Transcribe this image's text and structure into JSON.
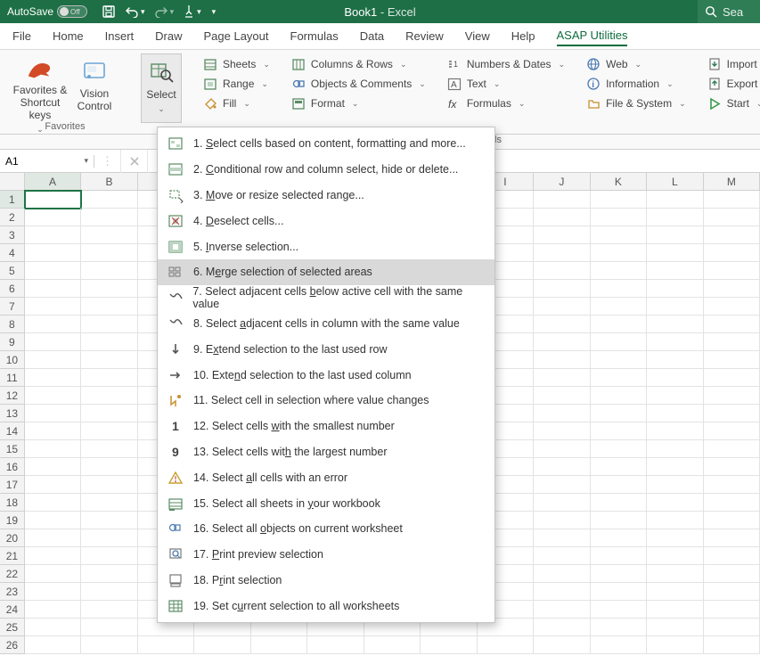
{
  "titlebar": {
    "autosave_label": "AutoSave",
    "autosave_state": "Off",
    "title_doc": "Book1",
    "title_app": "Excel",
    "search_placeholder": "Sea"
  },
  "tabs": {
    "items": [
      {
        "label": "File"
      },
      {
        "label": "Home"
      },
      {
        "label": "Insert"
      },
      {
        "label": "Draw"
      },
      {
        "label": "Page Layout"
      },
      {
        "label": "Formulas"
      },
      {
        "label": "Data"
      },
      {
        "label": "Review"
      },
      {
        "label": "View"
      },
      {
        "label": "Help"
      },
      {
        "label": "ASAP Utilities"
      }
    ],
    "active_index": 10
  },
  "ribbon": {
    "favorites": {
      "label": "Favorites",
      "big1": "Favorites &\nShortcut keys",
      "big2": "Vision\nControl"
    },
    "select_big": "Select",
    "col1": [
      {
        "label": "Sheets"
      },
      {
        "label": "Range"
      },
      {
        "label": "Fill"
      }
    ],
    "col2": [
      {
        "label": "Columns & Rows"
      },
      {
        "label": "Objects & Comments"
      },
      {
        "label": "Format"
      }
    ],
    "col3": [
      {
        "label": "Numbers & Dates"
      },
      {
        "label": "Text"
      },
      {
        "label": "Formulas"
      }
    ],
    "col4": [
      {
        "label": "Web"
      },
      {
        "label": "Information"
      },
      {
        "label": "File & System"
      }
    ],
    "col5": [
      {
        "label": "Import"
      },
      {
        "label": "Export"
      },
      {
        "label": "Start"
      }
    ],
    "cells_label": "ls"
  },
  "namebox": {
    "value": "A1"
  },
  "columns": [
    "A",
    "B",
    "",
    "",
    "",
    "",
    "",
    "",
    "I",
    "J",
    "K",
    "L",
    "M"
  ],
  "row_count": 26,
  "active_cell": {
    "row": 1,
    "col": 0
  },
  "dropdown": {
    "highlight_index": 5,
    "items": [
      {
        "num": "1.",
        "label": "Select cells based on content, formatting and more...",
        "ukey": "S"
      },
      {
        "num": "2.",
        "label": "Conditional row and column select, hide or delete...",
        "ukey": "C"
      },
      {
        "num": "3.",
        "label": "Move or resize selected range...",
        "ukey": "M"
      },
      {
        "num": "4.",
        "label": "Deselect cells...",
        "ukey": "D"
      },
      {
        "num": "5.",
        "label": "Inverse selection...",
        "ukey": "I"
      },
      {
        "num": "6.",
        "label": "Merge selection of selected areas",
        "ukey": "e"
      },
      {
        "num": "7.",
        "label": "Select adjacent cells below active cell with the same value",
        "ukey": "b"
      },
      {
        "num": "8.",
        "label": "Select adjacent cells in column with the same value",
        "ukey": "a"
      },
      {
        "num": "9.",
        "label": "Extend selection to the last used row",
        "ukey": "x"
      },
      {
        "num": "10.",
        "label": "Extend selection to the last used column",
        "ukey": "n"
      },
      {
        "num": "11.",
        "label": "Select cell in selection where value changes",
        "ukey": ""
      },
      {
        "num": "12.",
        "label": "Select cells with the smallest number",
        "ukey": "w"
      },
      {
        "num": "13.",
        "label": "Select cells with the largest number",
        "ukey": "h"
      },
      {
        "num": "14.",
        "label": "Select all cells with an error",
        "ukey": "a"
      },
      {
        "num": "15.",
        "label": "Select all sheets in your workbook",
        "ukey": "y"
      },
      {
        "num": "16.",
        "label": "Select all objects on current worksheet",
        "ukey": "o"
      },
      {
        "num": "17.",
        "label": "Print preview selection",
        "ukey": "P"
      },
      {
        "num": "18.",
        "label": "Print selection",
        "ukey": "r"
      },
      {
        "num": "19.",
        "label": "Set current selection to all worksheets",
        "ukey": "u"
      }
    ]
  }
}
